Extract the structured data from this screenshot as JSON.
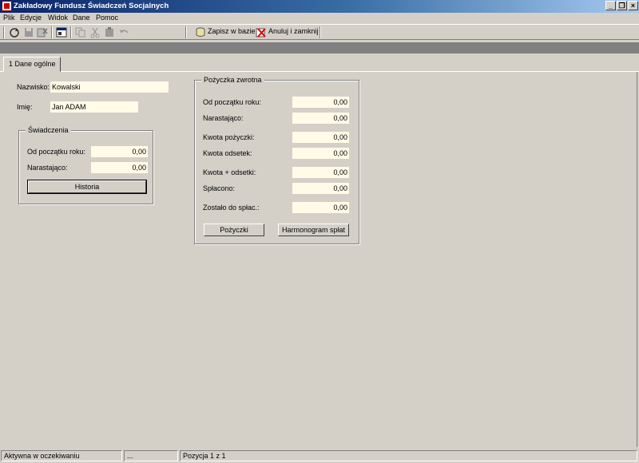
{
  "window": {
    "title": "Zakładowy Fundusz Świadczeń Socjalnych",
    "controls": [
      "_",
      "❐",
      "×"
    ]
  },
  "menu": {
    "items": [
      "Plik",
      "Edycje",
      "Widok",
      "Dane",
      "Pomoc"
    ]
  },
  "toolbar": {
    "icons": [
      "refresh-icon",
      "save-disk-icon",
      "delete-icon",
      "properties-icon",
      "copy-icon",
      "cut-icon",
      "paste-icon",
      "undo-icon"
    ],
    "save_label": "Zapisz w bazie",
    "cancel_label": "Anuluj i zamknij"
  },
  "tabs": [
    {
      "label": "1 Dane ogólne",
      "active": true
    }
  ],
  "form": {
    "surname_label": "Nazwisko:",
    "surname_value": "Kowalski",
    "name_label": "Imię:",
    "name_value": "Jan ADAM"
  },
  "benefits": {
    "title": "Świadczenia",
    "ytd_label": "Od początku roku:",
    "ytd_value": "0,00",
    "cumulative_label": "Narastająco:",
    "cumulative_value": "0,00",
    "history_button": "Historia"
  },
  "loan": {
    "title": "Pożyczka zwrotna",
    "rows": [
      {
        "label": "Od początku roku:",
        "value": "0,00"
      },
      {
        "label": "Narastająco:",
        "value": "0,00"
      },
      {
        "label": "Kwota pożyczki:",
        "value": "0,00"
      },
      {
        "label": "Kwota odsetek:",
        "value": "0,00"
      },
      {
        "label": "Kwota + odsetki:",
        "value": "0,00"
      },
      {
        "label": "Spłacono:",
        "value": "0,00"
      },
      {
        "label": "Zostało do spłac.:",
        "value": "0,00"
      }
    ],
    "loans_button": "Pożyczki",
    "schedule_button": "Harmonogram spłat"
  },
  "status": {
    "state": "Aktywna w oczekiwaniu",
    "extra": "...",
    "position": "Pozycja 1 z 1"
  },
  "colors": {
    "background": "#d4d0c8",
    "field": "#fffbe6",
    "title_start": "#0a246a",
    "title_end": "#a6caf0"
  }
}
